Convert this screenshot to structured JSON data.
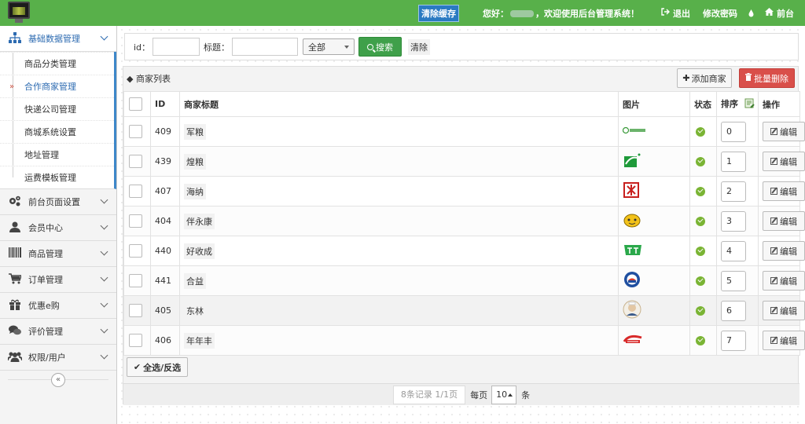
{
  "topbar": {
    "clear_cache": "清除缓存",
    "greeting_prefix": "您好：",
    "greeting_suffix": "，欢迎使用后台管理系统！",
    "logout": "退出",
    "change_password": "修改密码",
    "front": "前台"
  },
  "sidebar": {
    "active_group": "基础数据管理",
    "sub_items": [
      "商品分类管理",
      "合作商家管理",
      "快递公司管理",
      "商城系统设置",
      "地址管理",
      "运费模板管理"
    ],
    "groups": [
      "前台页面设置",
      "会员中心",
      "商品管理",
      "订单管理",
      "优惠e购",
      "评价管理",
      "权限/用户"
    ],
    "collapse_symbol": "«"
  },
  "search": {
    "id_label": "id：",
    "title_label": "标题：",
    "select_value": "全部",
    "search_button": "搜索",
    "clear_button": "清除"
  },
  "list": {
    "title": "◆ 商家列表",
    "add_button": "添加商家",
    "batch_delete_button": "批量删除",
    "columns": [
      "ID",
      "商家标题",
      "图片",
      "状态",
      "排序",
      "操作"
    ],
    "edit_label": "编辑",
    "rows": [
      {
        "id": "409",
        "title": "军粮",
        "sort": "0",
        "logo": "logo-junliang"
      },
      {
        "id": "439",
        "title": "煌粮",
        "sort": "1",
        "logo": "logo-huangliang"
      },
      {
        "id": "407",
        "title": "海纳",
        "sort": "2",
        "logo": "logo-haina"
      },
      {
        "id": "404",
        "title": "伴永康",
        "sort": "3",
        "logo": "logo-banyongkang"
      },
      {
        "id": "440",
        "title": "好收成",
        "sort": "4",
        "logo": "logo-haoshoucheng"
      },
      {
        "id": "441",
        "title": "合益",
        "sort": "5",
        "logo": "logo-heyi"
      },
      {
        "id": "405",
        "title": "东林",
        "sort": "6",
        "logo": "logo-donglin"
      },
      {
        "id": "406",
        "title": "年年丰",
        "sort": "7",
        "logo": "logo-niannianfeng"
      }
    ],
    "select_all_button": "全选/反选"
  },
  "pager": {
    "records": "8条记录 1/1页",
    "per_page_label": "每页",
    "page_size": "10",
    "unit": "条"
  },
  "colors": {
    "topbar": "#58b04a",
    "active_menu": "#2d6bb1",
    "search_button": "#3fa04a",
    "delete_button": "#d94f4a",
    "status_ok": "#7ab434"
  }
}
